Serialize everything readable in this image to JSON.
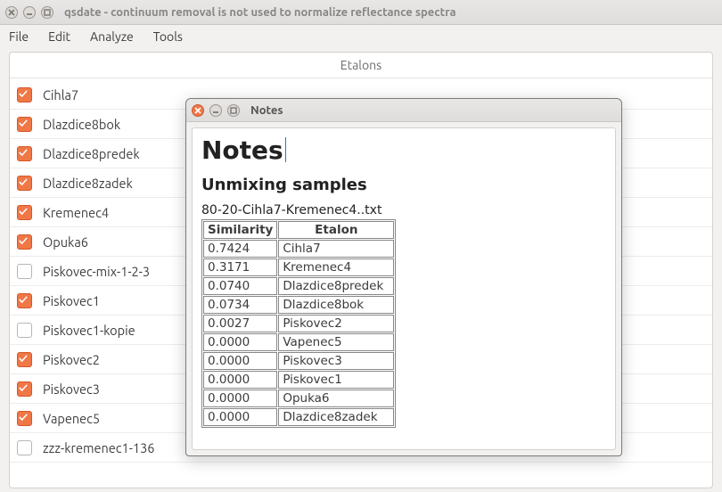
{
  "main": {
    "title": "qsdate - continuum removal is not used to normalize reflectance spectra",
    "menu": {
      "file": "File",
      "edit": "Edit",
      "analyze": "Analyze",
      "tools": "Tools"
    },
    "panel_title": "Etalons",
    "etalons": [
      {
        "name": "Cihla7",
        "checked": true
      },
      {
        "name": "Dlazdice8bok",
        "checked": true
      },
      {
        "name": "Dlazdice8predek",
        "checked": true
      },
      {
        "name": "Dlazdice8zadek",
        "checked": true
      },
      {
        "name": "Kremenec4",
        "checked": true
      },
      {
        "name": "Opuka6",
        "checked": true
      },
      {
        "name": "Piskovec-mix-1-2-3",
        "checked": false
      },
      {
        "name": "Piskovec1",
        "checked": true
      },
      {
        "name": "Piskovec1-kopie",
        "checked": false
      },
      {
        "name": "Piskovec2",
        "checked": true
      },
      {
        "name": "Piskovec3",
        "checked": true
      },
      {
        "name": "Vapenec5",
        "checked": true
      },
      {
        "name": "zzz-kremenec1-136",
        "checked": false
      }
    ]
  },
  "notes": {
    "window_title": "Notes",
    "h1": "Notes",
    "h2": "Unmixing samples",
    "caption": "80-20-Cihla7-Kremenec4..txt",
    "table": {
      "head_sim": "Similarity",
      "head_etalon": "Etalon",
      "rows": [
        {
          "sim": "0.7424",
          "etalon": "Cihla7"
        },
        {
          "sim": "0.3171",
          "etalon": "Kremenec4"
        },
        {
          "sim": "0.0740",
          "etalon": "Dlazdice8predek"
        },
        {
          "sim": "0.0734",
          "etalon": "Dlazdice8bok"
        },
        {
          "sim": "0.0027",
          "etalon": "Piskovec2"
        },
        {
          "sim": "0.0000",
          "etalon": "Vapenec5"
        },
        {
          "sim": "0.0000",
          "etalon": "Piskovec3"
        },
        {
          "sim": "0.0000",
          "etalon": "Piskovec1"
        },
        {
          "sim": "0.0000",
          "etalon": "Opuka6"
        },
        {
          "sim": "0.0000",
          "etalon": "Dlazdice8zadek"
        }
      ]
    }
  }
}
